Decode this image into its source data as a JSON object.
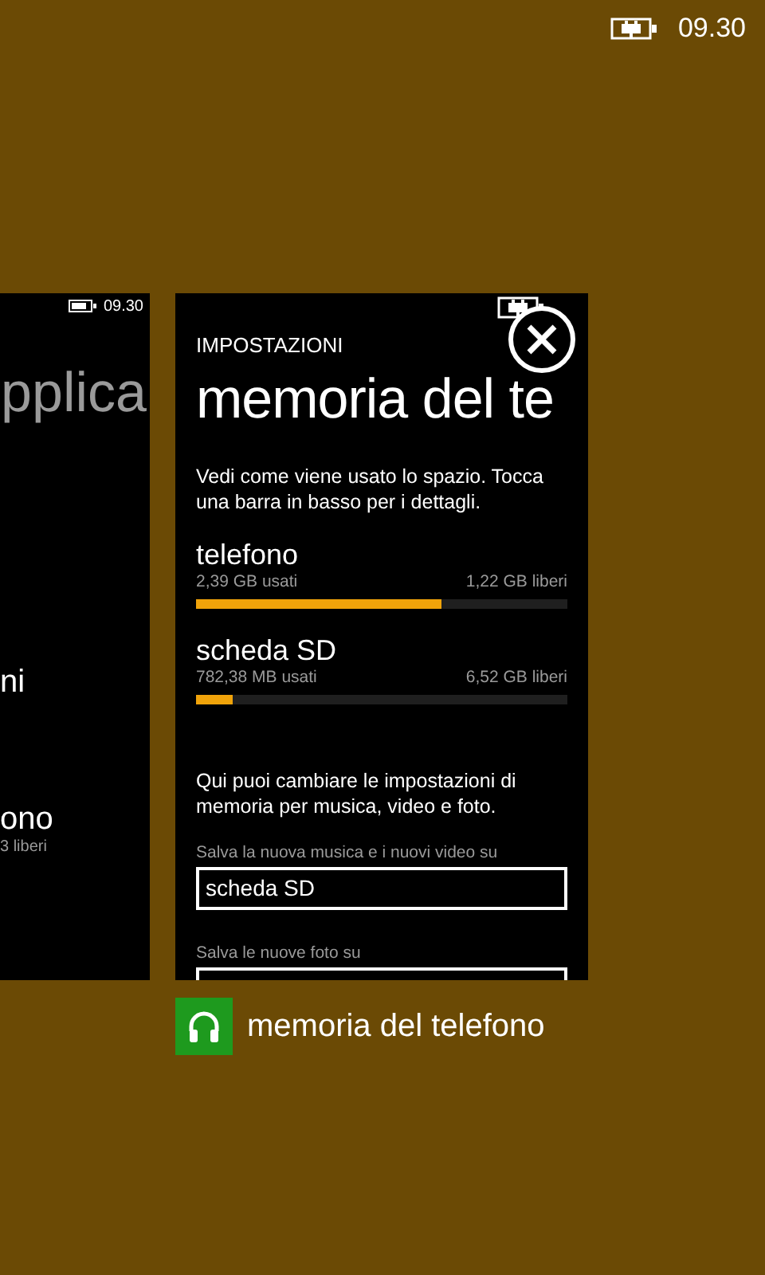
{
  "status_bar": {
    "time": "09.30"
  },
  "previous_card": {
    "time": "09.30",
    "title": "pplica",
    "items": [
      {
        "name": "ni"
      },
      {
        "name": "ono",
        "detail": "3 liberi"
      }
    ]
  },
  "card": {
    "section": "IMPOSTAZIONI",
    "title": "memoria del te",
    "intro": "Vedi come viene usato lo spazio. Tocca una barra in basso per i dettagli.",
    "storage": [
      {
        "name": "telefono",
        "used": "2,39 GB usati",
        "free": "1,22 GB liberi",
        "level": 0.66
      },
      {
        "name": "scheda SD",
        "used": "782,38 MB usati",
        "free": "6,52 GB liberi",
        "level": 0.1
      }
    ],
    "settings_intro": "Qui puoi cambiare le impostazioni di memoria per musica, video e foto.",
    "fields": [
      {
        "label": "Salva la nuova musica e i nuovi video su",
        "value": "scheda SD"
      },
      {
        "label": "Salva le nuove foto su"
      }
    ]
  },
  "caption": {
    "title": "memoria del telefono"
  }
}
